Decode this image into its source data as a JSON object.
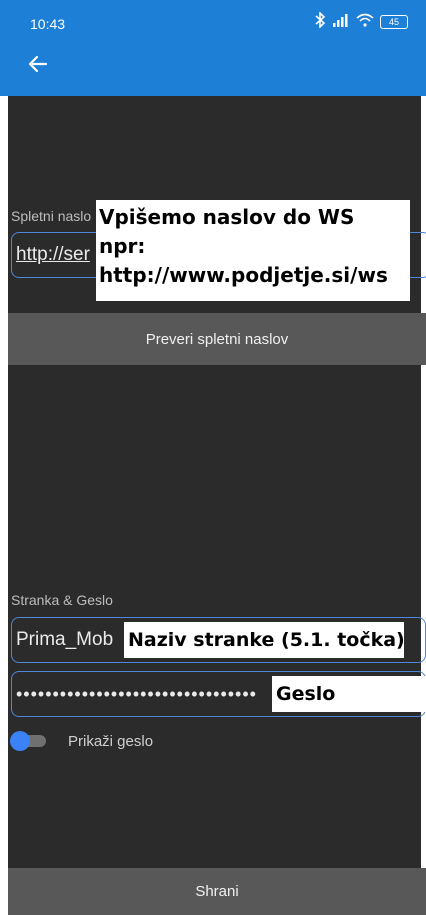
{
  "status_bar": {
    "time": "10:43",
    "battery": "45"
  },
  "web_address": {
    "label": "Spletni naslo",
    "value": "http://ser",
    "check_button": "Preveri spletni naslov"
  },
  "credentials": {
    "section_label": "Stranka & Geslo",
    "client_value": "Prima_Mob",
    "password_masked": "•••••••••••••••••••••••••••••••••",
    "show_password_label": "Prikaži geslo"
  },
  "save_button": "Shrani",
  "annotations": {
    "url_note": [
      "Vpišemo naslov do WS",
      "npr:",
      "http://www.podjetje.si/ws"
    ],
    "client_note": "Naziv stranke (5.1. točka)",
    "password_note": "Geslo"
  },
  "colors": {
    "app_bar": "#1e7fd6",
    "background": "#2b2b2b",
    "button": "#585858",
    "field_border": "#4f86d9",
    "toggle_knob": "#3b82f6"
  },
  "icons": {
    "back": "arrow-left-icon",
    "bluetooth": "bluetooth-icon",
    "signal": "signal-icon",
    "wifi": "wifi-icon",
    "battery": "battery-icon"
  }
}
